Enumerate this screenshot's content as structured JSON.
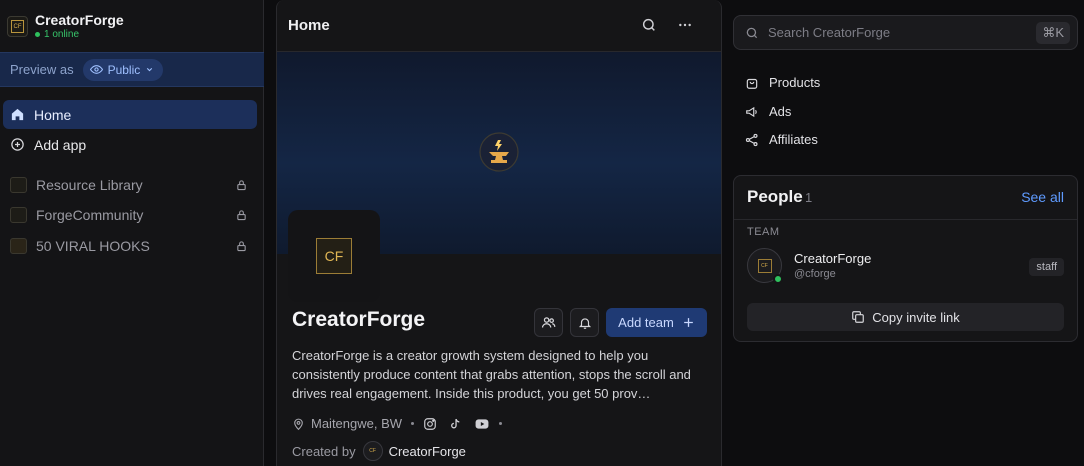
{
  "sidebar": {
    "brand_name": "CreatorForge",
    "brand_online": "1 online",
    "logo_text": "CF",
    "preview_label": "Preview as",
    "visibility": "Public",
    "nav": [
      {
        "label": "Home",
        "icon": "home-icon"
      },
      {
        "label": "Add app",
        "icon": "plus-circle-icon"
      }
    ],
    "apps": [
      {
        "label": "Resource Library",
        "locked": true
      },
      {
        "label": "ForgeCommunity",
        "locked": true
      },
      {
        "label": "50 VIRAL HOOKS",
        "locked": true
      }
    ]
  },
  "main": {
    "header_title": "Home",
    "profile_name": "CreatorForge",
    "avatar_text": "CF",
    "add_team_label": "Add team",
    "description": "CreatorForge is a creator growth system designed to help you consistently produce content that grabs attention, stops the scroll and drives real engagement. Inside this product, you get 50 prov…",
    "location": "Maitengwe, BW",
    "social_icons": [
      "instagram-icon",
      "tiktok-icon",
      "youtube-icon"
    ],
    "created_by_label": "Created by",
    "created_by_name": "CreatorForge"
  },
  "right": {
    "search_placeholder": "Search CreatorForge",
    "search_shortcut": "⌘K",
    "links": [
      {
        "label": "Products",
        "icon": "bag-icon"
      },
      {
        "label": "Ads",
        "icon": "megaphone-icon"
      },
      {
        "label": "Affiliates",
        "icon": "share-icon"
      }
    ],
    "people": {
      "title": "People",
      "count": "1",
      "see_all": "See all",
      "team_label": "TEAM",
      "member": {
        "name": "CreatorForge",
        "handle": "@cforge",
        "role": "staff",
        "avatar_text": "CF"
      },
      "copy_label": "Copy invite link"
    }
  },
  "colors": {
    "accent": "#1f3a74",
    "link": "#5f9bff",
    "online": "#2fc15e",
    "gold": "#d8ae4c"
  }
}
